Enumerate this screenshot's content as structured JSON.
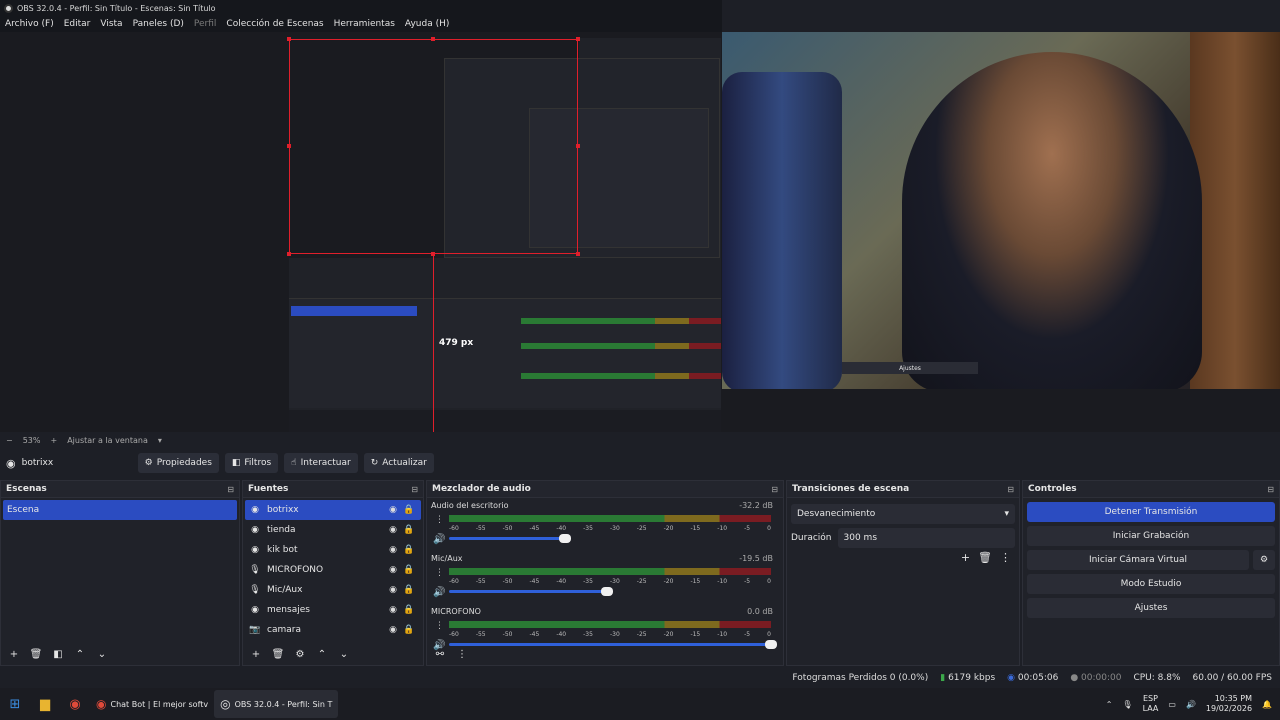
{
  "window": {
    "title": "OBS 32.0.4 - Perfil: Sin Título - Escenas: Sin Título"
  },
  "menu": [
    "Archivo (F)",
    "Editar",
    "Vista",
    "Paneles (D)",
    "Perfil",
    "Colección de Escenas",
    "Herramientas",
    "Ayuda (H)"
  ],
  "zoom": {
    "minus": "−",
    "value": "53%",
    "plus": "+",
    "fit": "Ajustar a la ventana"
  },
  "source_toolbar": {
    "name": "botrixx",
    "properties": "Propiedades",
    "filters": "Filtros",
    "interact": "Interactuar",
    "refresh": "Actualizar"
  },
  "nested": {
    "size_label": "479 px"
  },
  "scenes": {
    "title": "Escenas",
    "items": [
      "Escena"
    ]
  },
  "sources": {
    "title": "Fuentes",
    "items": [
      {
        "label": "botrixx",
        "icon": "globe-icon"
      },
      {
        "label": "tienda",
        "icon": "globe-icon"
      },
      {
        "label": "kik bot",
        "icon": "globe-icon"
      },
      {
        "label": "MICROFONO",
        "icon": "mic-icon"
      },
      {
        "label": "Mic/Aux",
        "icon": "mic-icon"
      },
      {
        "label": "mensajes",
        "icon": "globe-icon"
      },
      {
        "label": "camara",
        "icon": "camera-icon"
      }
    ]
  },
  "mixer": {
    "title": "Mezclador de audio",
    "channels": [
      {
        "name": "Audio del escritorio",
        "db": "-32.2 dB",
        "volume": 0.36
      },
      {
        "name": "Mic/Aux",
        "db": "-19.5 dB",
        "volume": 0.49
      },
      {
        "name": "MICROFONO",
        "db": "0.0 dB",
        "volume": 1.0
      }
    ],
    "scale": [
      "-60",
      "-55",
      "-50",
      "-45",
      "-40",
      "-35",
      "-30",
      "-25",
      "-20",
      "-15",
      "-10",
      "-5",
      "0"
    ]
  },
  "transitions": {
    "title": "Transiciones de escena",
    "selected": "Desvanecimiento",
    "duration_label": "Duración",
    "duration": "300 ms"
  },
  "controls": {
    "title": "Controles",
    "stop_stream": "Detener Transmisión",
    "start_rec": "Iniciar Grabación",
    "virtual_cam": "Iniciar Cámara Virtual",
    "studio": "Modo Estudio",
    "settings": "Ajustes"
  },
  "status": {
    "dropped": "Fotogramas Perdidos 0 (0.0%)",
    "kbps": "6179 kbps",
    "stream_time": "00:05:06",
    "rec_time": "00:00:00",
    "cpu": "CPU: 8.8%",
    "fps": "60.00 / 60.00 FPS"
  },
  "taskbar": {
    "app1": "Chat Bot | El mejor softv",
    "app2": "OBS 32.0.4 - Perfil: Sin T",
    "lang": "ESP",
    "lang2": "LAA",
    "time": "10:35 PM",
    "date": "19/02/2026"
  },
  "colors": {
    "accent": "#2b4cc1",
    "red": "#e01f2b"
  }
}
